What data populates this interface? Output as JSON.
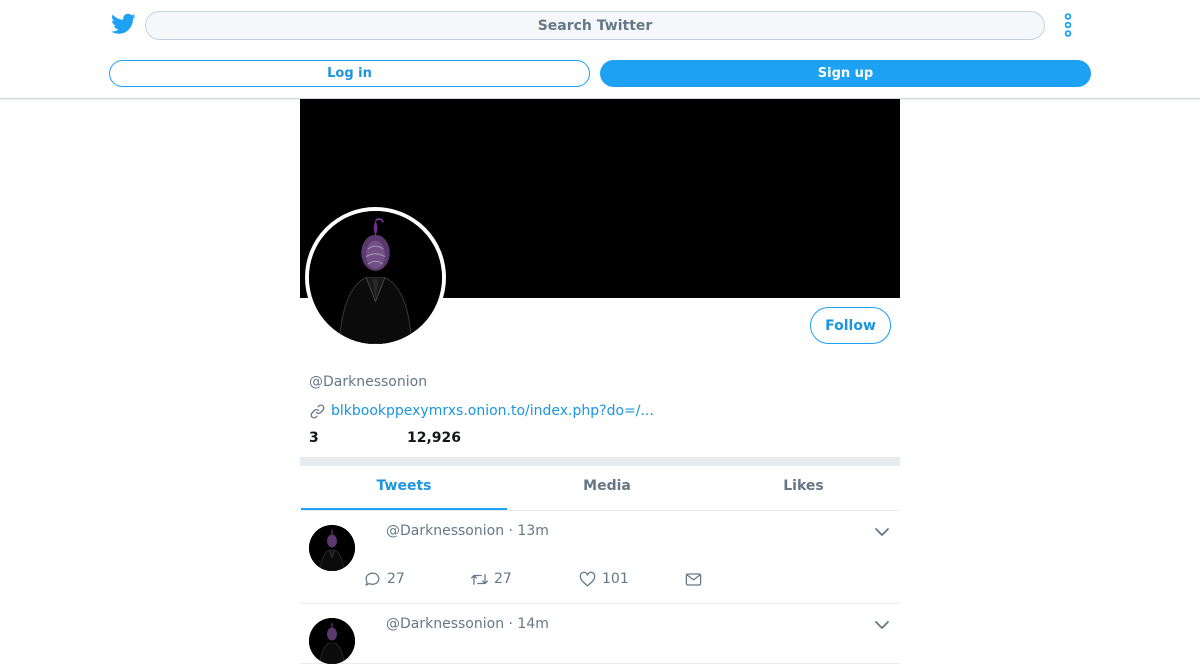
{
  "header": {
    "search_placeholder": "Search Twitter",
    "login_label": "Log in",
    "signup_label": "Sign up"
  },
  "profile": {
    "handle": "@Darknessonion",
    "link": "blkbookppexymrxs.onion.to/index.php?do=/...",
    "following_count": "3",
    "followers_count": "12,926",
    "follow_label": "Follow"
  },
  "tabs": [
    {
      "label": "Tweets",
      "active": true
    },
    {
      "label": "Media",
      "active": false
    },
    {
      "label": "Likes",
      "active": false
    }
  ],
  "tweets": [
    {
      "header": "@Darknessonion · 13m",
      "replies": "27",
      "retweets": "27",
      "likes": "101"
    },
    {
      "header": "@Darknessonion · 14m"
    }
  ],
  "colors": {
    "accent": "#1da1f2",
    "link": "#1b95e0",
    "muted": "#657786",
    "divider": "#e6ecf0",
    "banner": "#000000"
  },
  "icons": {
    "logo": "twitter-bird-icon",
    "more": "vertical-dots-icon",
    "link": "link-chain-icon",
    "reply": "reply-bubble-icon",
    "retweet": "retweet-icon",
    "like": "heart-icon",
    "dm": "envelope-icon",
    "menu": "chevron-down-icon"
  }
}
